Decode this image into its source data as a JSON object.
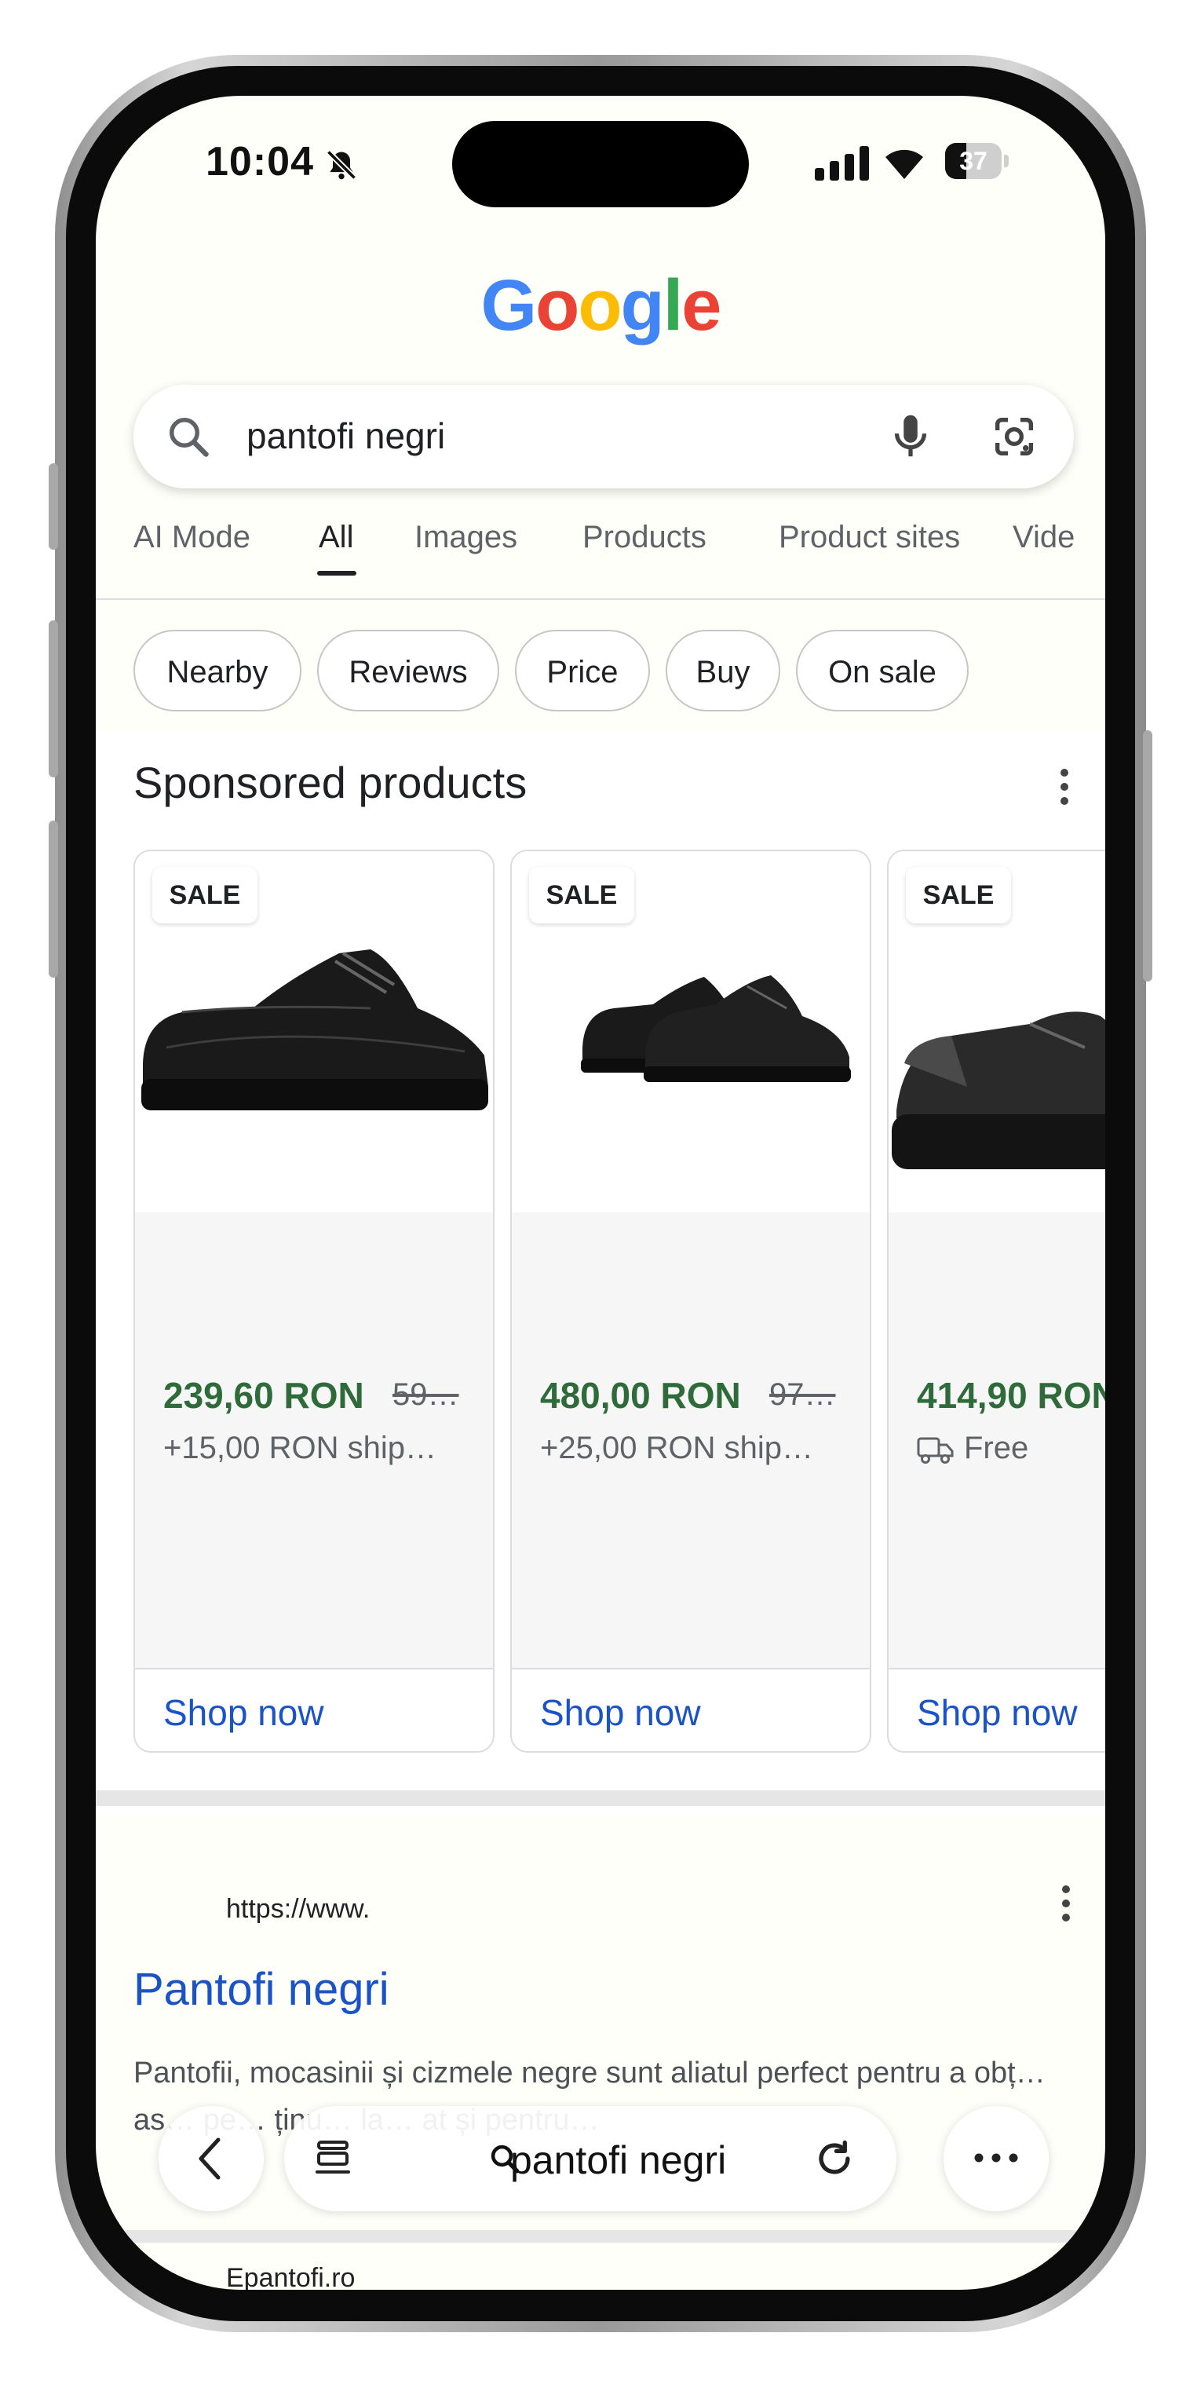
{
  "status_bar": {
    "time": "10:04",
    "battery_level": "37"
  },
  "logo": {
    "text": "Google",
    "letters": [
      "G",
      "o",
      "o",
      "g",
      "l",
      "e"
    ],
    "colors": [
      "#4285F4",
      "#EA4335",
      "#FBBC05",
      "#4285F4",
      "#34A853",
      "#EA4335"
    ]
  },
  "search": {
    "query": "pantofi negri"
  },
  "tabs": [
    {
      "label": "AI Mode"
    },
    {
      "label": "All",
      "active": true
    },
    {
      "label": "Images"
    },
    {
      "label": "Products"
    },
    {
      "label": "Product sites"
    },
    {
      "label": "Vide"
    }
  ],
  "chips": [
    {
      "label": "Nearby"
    },
    {
      "label": "Reviews"
    },
    {
      "label": "Price"
    },
    {
      "label": "Buy"
    },
    {
      "label": "On sale"
    }
  ],
  "sponsored": {
    "title": "Sponsored products",
    "products": [
      {
        "badge": "SALE",
        "price": "239,60 RON",
        "old_price": "59…",
        "shipping": "+15,00 RON ship…",
        "cta": "Shop now"
      },
      {
        "badge": "SALE",
        "price": "480,00 RON",
        "old_price": "97…",
        "shipping": "+25,00 RON ship…",
        "cta": "Shop now"
      },
      {
        "badge": "SALE",
        "price": "414,90 RON",
        "old_price": "",
        "shipping": "Free",
        "cta": "Shop now"
      }
    ]
  },
  "result": {
    "url": "https://www.",
    "title": "Pantofi negri",
    "snippet": "Pantofii, mocasinii și cizmele negre sunt aliatul perfect pentru a obț… as… pe… ținu… la… at și pentru…"
  },
  "bottom_bar": {
    "query": "pantofi negri"
  },
  "next_result": {
    "url": "Epantofi.ro"
  },
  "colors": {
    "link": "#1a53c6",
    "price": "#2f6b3a",
    "text": "#202124",
    "muted": "#5f6368"
  }
}
